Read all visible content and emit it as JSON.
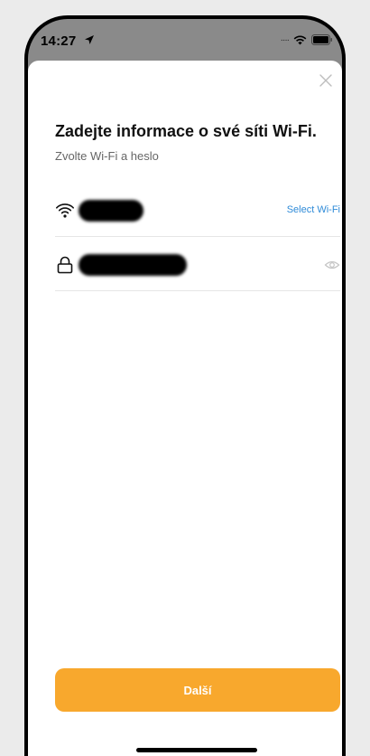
{
  "status_bar": {
    "time": "14:27",
    "location_icon": "location-arrow-icon",
    "signal_icon": "cellular-dots-icon",
    "wifi_icon": "wifi-icon",
    "battery_icon": "battery-icon"
  },
  "sheet": {
    "close_icon": "close-icon",
    "title": "Zadejte informace o své síti Wi-Fi.",
    "subtitle": "Zvolte Wi-Fi a heslo",
    "wifi_row": {
      "icon": "wifi-icon",
      "select_label": "Select Wi-Fi"
    },
    "password_row": {
      "icon": "lock-icon",
      "visibility_icon": "eye-icon"
    },
    "next_button_label": "Další"
  },
  "colors": {
    "accent": "#f8a82d",
    "link": "#2f8bd8",
    "backdrop": "#8a8a8a"
  }
}
